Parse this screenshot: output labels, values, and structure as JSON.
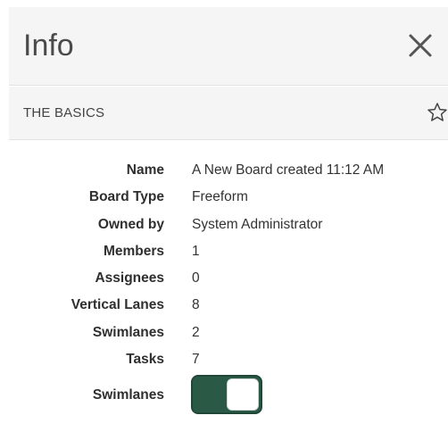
{
  "panel": {
    "title": "Info",
    "section_title": "THE BASICS"
  },
  "details": [
    {
      "label": "Name",
      "value": "A New Board created 11:12 AM"
    },
    {
      "label": "Board Type",
      "value": "Freeform"
    },
    {
      "label": "Owned by",
      "value": "System Administrator"
    },
    {
      "label": "Members",
      "value": "1"
    },
    {
      "label": "Assignees",
      "value": "0"
    },
    {
      "label": "Vertical Lanes",
      "value": "8"
    },
    {
      "label": "Swimlanes",
      "value": "2"
    },
    {
      "label": "Tasks",
      "value": "7"
    }
  ],
  "swimlanes_toggle": {
    "label": "Swimlanes",
    "state": "on",
    "accent_color": "#2a5946"
  },
  "icons": {
    "close": "close-icon",
    "favorite": "star-outline-icon"
  }
}
